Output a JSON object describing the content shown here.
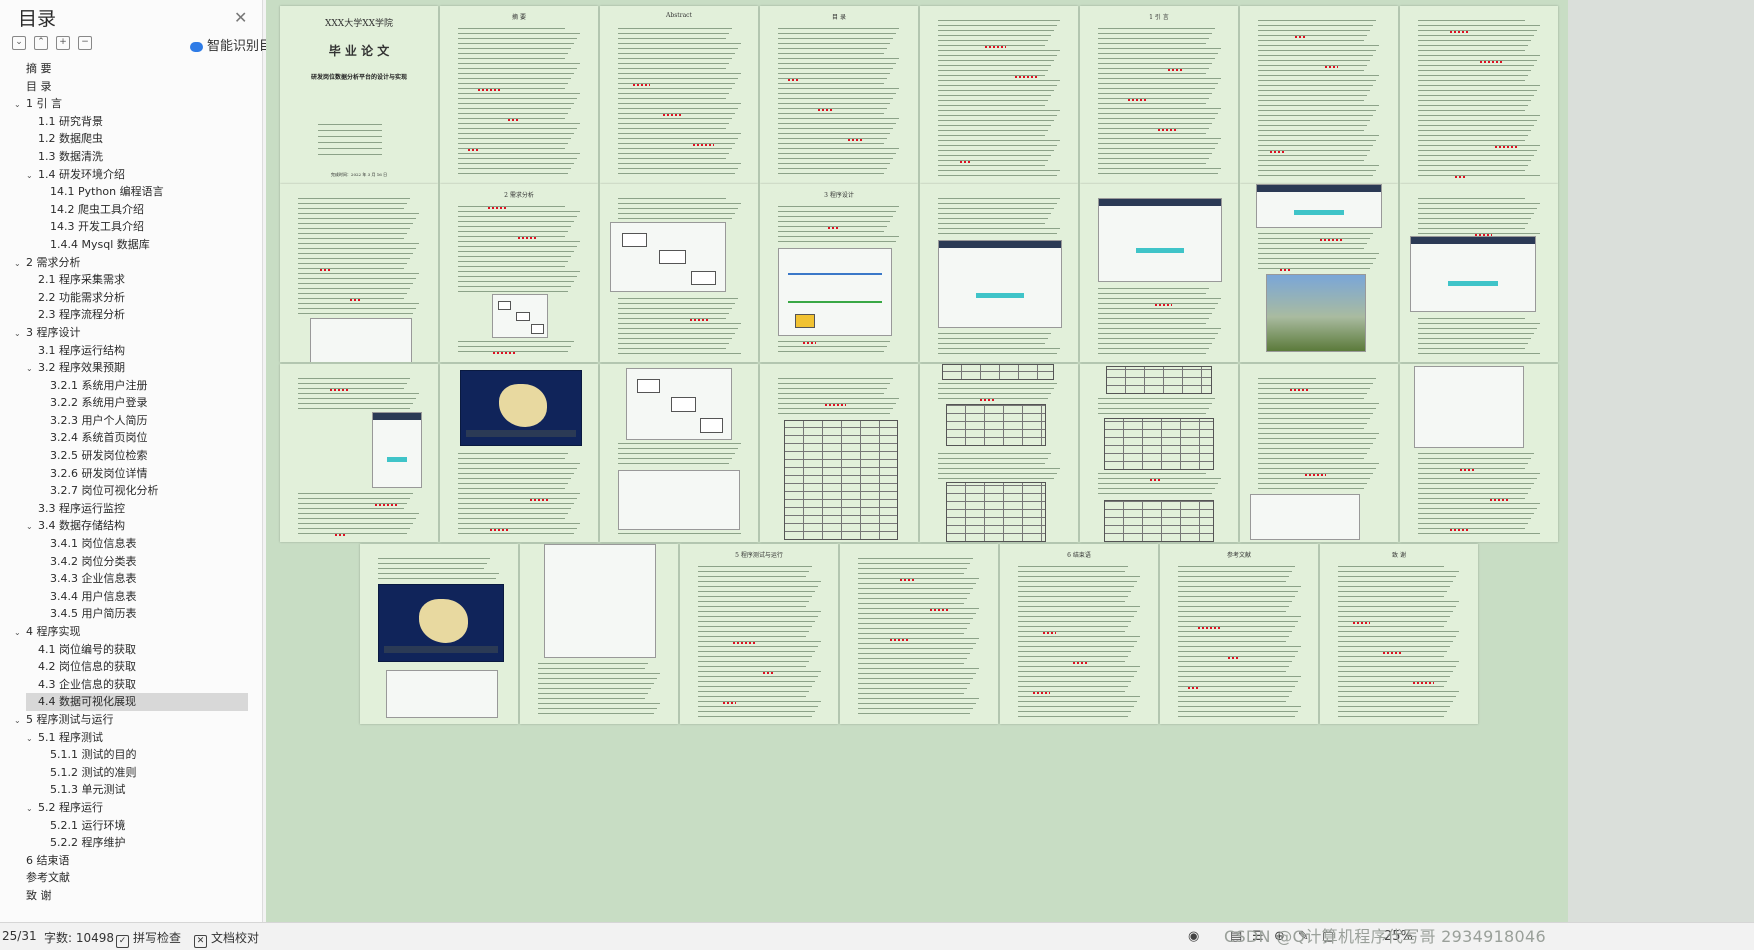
{
  "sidebar": {
    "title": "目录",
    "close_icon": "close-icon",
    "toolbar_icons": [
      "collapse-all-icon",
      "expand-one-icon",
      "add-heading-icon",
      "remove-heading-icon"
    ],
    "smart_label": "智能识别目录",
    "items": [
      {
        "label": "摘    要",
        "level": 0,
        "chevron": ""
      },
      {
        "label": "目    录",
        "level": 0,
        "chevron": ""
      },
      {
        "label": "1 引 言",
        "level": 0,
        "chevron": "v"
      },
      {
        "label": "1.1 研究背景",
        "level": 1,
        "chevron": ""
      },
      {
        "label": "1.2 数据爬虫",
        "level": 1,
        "chevron": ""
      },
      {
        "label": "1.3 数据清洗",
        "level": 1,
        "chevron": ""
      },
      {
        "label": "1.4 研发环境介绍",
        "level": 1,
        "chevron": "v"
      },
      {
        "label": "14.1 Python 编程语言",
        "level": 2,
        "chevron": ""
      },
      {
        "label": "14.2 爬虫工具介绍",
        "level": 2,
        "chevron": ""
      },
      {
        "label": "14.3 开发工具介绍",
        "level": 2,
        "chevron": ""
      },
      {
        "label": "1.4.4 Mysql 数据库",
        "level": 2,
        "chevron": ""
      },
      {
        "label": "2 需求分析",
        "level": 0,
        "chevron": "v"
      },
      {
        "label": "2.1 程序采集需求",
        "level": 1,
        "chevron": ""
      },
      {
        "label": "2.2 功能需求分析",
        "level": 1,
        "chevron": ""
      },
      {
        "label": "2.3 程序流程分析",
        "level": 1,
        "chevron": ""
      },
      {
        "label": "3 程序设计",
        "level": 0,
        "chevron": "v"
      },
      {
        "label": "3.1 程序运行结构",
        "level": 1,
        "chevron": ""
      },
      {
        "label": "3.2 程序效果预期",
        "level": 1,
        "chevron": "v"
      },
      {
        "label": "3.2.1 系统用户注册",
        "level": 2,
        "chevron": ""
      },
      {
        "label": "3.2.2 系统用户登录",
        "level": 2,
        "chevron": ""
      },
      {
        "label": "3.2.3 用户个人简历",
        "level": 2,
        "chevron": ""
      },
      {
        "label": "3.2.4 系统首页岗位",
        "level": 2,
        "chevron": ""
      },
      {
        "label": "3.2.5 研发岗位检索",
        "level": 2,
        "chevron": ""
      },
      {
        "label": "3.2.6 研发岗位详情",
        "level": 2,
        "chevron": ""
      },
      {
        "label": "3.2.7 岗位可视化分析",
        "level": 2,
        "chevron": ""
      },
      {
        "label": "3.3 程序运行监控",
        "level": 1,
        "chevron": ""
      },
      {
        "label": "3.4 数据存储结构",
        "level": 1,
        "chevron": "v"
      },
      {
        "label": "3.4.1 岗位信息表",
        "level": 2,
        "chevron": ""
      },
      {
        "label": "3.4.2 岗位分类表",
        "level": 2,
        "chevron": ""
      },
      {
        "label": "3.4.3 企业信息表",
        "level": 2,
        "chevron": ""
      },
      {
        "label": "3.4.4 用户信息表",
        "level": 2,
        "chevron": ""
      },
      {
        "label": "3.4.5 用户简历表",
        "level": 2,
        "chevron": ""
      },
      {
        "label": "4 程序实现",
        "level": 0,
        "chevron": "v"
      },
      {
        "label": "4.1 岗位编号的获取",
        "level": 1,
        "chevron": ""
      },
      {
        "label": "4.2 岗位信息的获取",
        "level": 1,
        "chevron": ""
      },
      {
        "label": "4.3 企业信息的获取",
        "level": 1,
        "chevron": ""
      },
      {
        "label": "4.4 数据可视化展现",
        "level": 1,
        "chevron": "",
        "selected": true
      },
      {
        "label": "5 程序测试与运行",
        "level": 0,
        "chevron": "v"
      },
      {
        "label": "5.1 程序测试",
        "level": 1,
        "chevron": "v"
      },
      {
        "label": "5.1.1 测试的目的",
        "level": 2,
        "chevron": ""
      },
      {
        "label": "5.1.2 测试的准则",
        "level": 2,
        "chevron": ""
      },
      {
        "label": "5.1.3 单元测试",
        "level": 2,
        "chevron": ""
      },
      {
        "label": "5.2 程序运行",
        "level": 1,
        "chevron": "v"
      },
      {
        "label": "5.2.1 运行环境",
        "level": 2,
        "chevron": ""
      },
      {
        "label": "5.2.2 程序维护",
        "level": 2,
        "chevron": ""
      },
      {
        "label": "6 结束语",
        "level": 0,
        "chevron": ""
      },
      {
        "label": "参考文献",
        "level": 0,
        "chevron": ""
      },
      {
        "label": "致    谢",
        "level": 0,
        "chevron": ""
      }
    ]
  },
  "cover": {
    "school": "XXX大学XX学院",
    "title": "毕 业 论 文",
    "subtitle": "研发岗位数据分析平台的设计与实现",
    "date": "完成时间：2022 年 3 月 16 日"
  },
  "pages": {
    "abstract_cn": "摘  要",
    "abstract_en": "Abstract",
    "toc": "目  录",
    "intro": "1  引  言",
    "req": "2 需求分析",
    "design": "3 程序设计",
    "impl": "4 程序实现",
    "test": "5 程序测试与运行",
    "conclusion": "6 结束语",
    "refs": "参考文献",
    "thanks": "致  谢"
  },
  "status": {
    "page": "25/31",
    "word_count": "字数: 10498",
    "spell_check": "拼写检查",
    "doc_check": "文档校对",
    "zoom": "25%",
    "watermark": "CSDN @Q计算机程序代写哥 2934918046"
  },
  "colors": {
    "page_bg": "#e2f0da",
    "canvas_bg": "#c8ddc4",
    "selection": "#d8d8d8",
    "squiggle": "#d12"
  }
}
